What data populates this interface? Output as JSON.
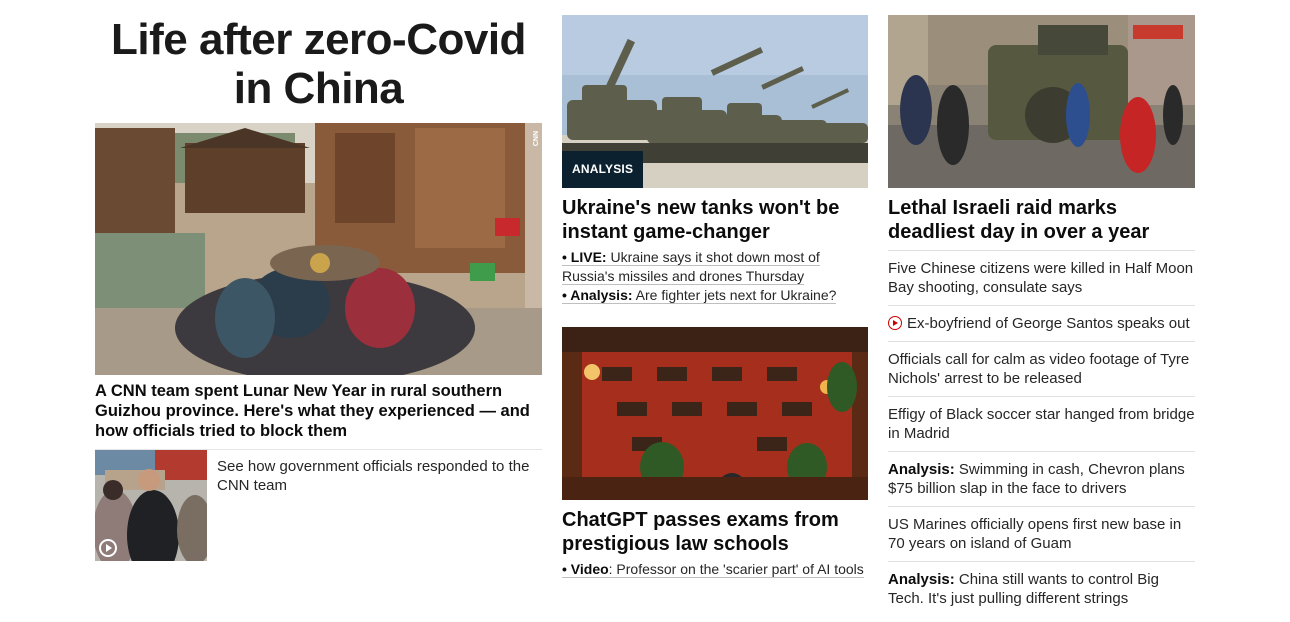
{
  "hero": {
    "title": "Life after zero-Covid in China",
    "headline": "A CNN team spent Lunar New Year in rural southern Guizhou province. Here's what they experienced — and how officials tried to block them",
    "image_label": "CNN",
    "sub_story": "See how government officials responded to the CNN team"
  },
  "stories": {
    "ukraine": {
      "tag": "ANALYSIS",
      "headline": "Ukraine's new tanks won't be instant game-changer",
      "bullets": [
        {
          "prefix": "• LIVE:",
          "text": "Ukraine says it shot down most of Russia's missiles and drones Thursday"
        },
        {
          "prefix": "• Analysis:",
          "text": "Are fighter jets next for Ukraine?"
        }
      ]
    },
    "chatgpt": {
      "headline": "ChatGPT passes exams from prestigious law schools",
      "bullet": {
        "prefix": "• Video",
        "text": ": Professor on the 'scarier part' of AI tools"
      }
    },
    "israel": {
      "headline": "Lethal Israeli raid marks deadliest day in over a year"
    }
  },
  "list": [
    {
      "prefix": "",
      "text": "Five Chinese citizens were killed in Half Moon Bay shooting, consulate says",
      "video": false
    },
    {
      "prefix": "",
      "text": "Ex-boyfriend of George Santos speaks out",
      "video": true
    },
    {
      "prefix": "",
      "text": "Officials call for calm as video footage of Tyre Nichols' arrest to be released",
      "video": false
    },
    {
      "prefix": "",
      "text": "Effigy of Black soccer star hanged from bridge in Madrid",
      "video": false
    },
    {
      "prefix": "Analysis:",
      "text": "Swimming in cash, Chevron plans $75 billion slap in the face to drivers",
      "video": false
    },
    {
      "prefix": "",
      "text": "US Marines officially opens first new base in 70 years on island of Guam",
      "video": false
    },
    {
      "prefix": "Analysis:",
      "text": "China still wants to control Big Tech. It's just pulling different strings",
      "video": false
    }
  ],
  "colors": {
    "analysis_tag": "#0c2130",
    "video_icon": "#cc0000",
    "divider": "#e0e0e0"
  },
  "icons": {
    "video": "play-circle-icon"
  }
}
